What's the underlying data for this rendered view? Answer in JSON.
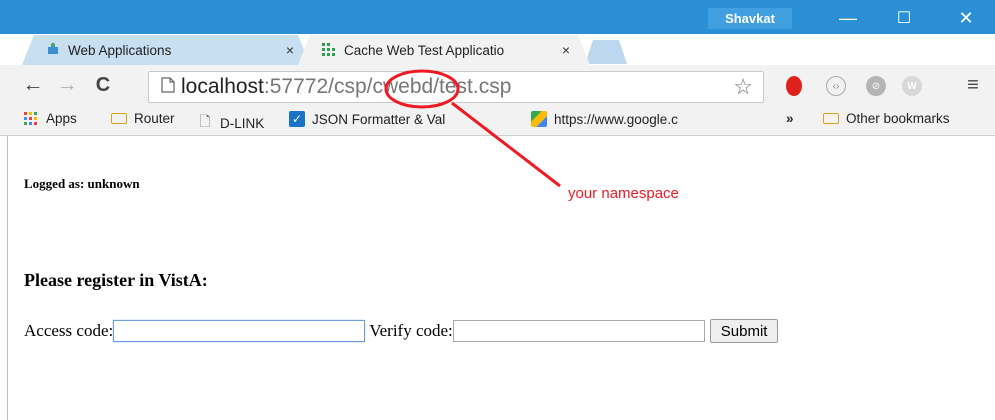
{
  "window": {
    "profile_name": "Shavkat",
    "minimize_glyph": "—",
    "maximize_glyph": "☐",
    "close_glyph": "✕",
    "accent_color": "#2b8fd6"
  },
  "tabs": [
    {
      "label": "Web Applications",
      "icon": "puzzle-icon",
      "close": "×"
    },
    {
      "label": "Cache Web Test Applicatio",
      "icon": "cache-app-icon",
      "close": "×"
    }
  ],
  "toolbar": {
    "back": "←",
    "forward": "→",
    "reload": "C",
    "url_host": "localhost",
    "url_rest": ":57772/csp/cwebd/test.csp",
    "star": "☆",
    "menu": "≡"
  },
  "bookmarks": {
    "items": [
      {
        "label": "Apps",
        "icon": "apps-grid-icon"
      },
      {
        "label": "Router",
        "icon": "folder-icon"
      },
      {
        "label": "D-LINK",
        "icon": "page-icon"
      },
      {
        "label": "JSON Formatter & Val",
        "icon": "checkbox-icon"
      },
      {
        "label": "https://www.google.c",
        "icon": "maps-icon"
      }
    ],
    "overflow": "»",
    "other": {
      "label": "Other bookmarks",
      "icon": "folder-icon"
    }
  },
  "page": {
    "logged_as": "Logged as: unknown",
    "heading": "Please register in VistA:",
    "access_label": "Access code:",
    "access_value": "",
    "verify_label": "Verify code:",
    "verify_value": "",
    "submit_label": "Submit"
  },
  "annotation": {
    "text": "your namespace",
    "color": "#ee1b24"
  }
}
